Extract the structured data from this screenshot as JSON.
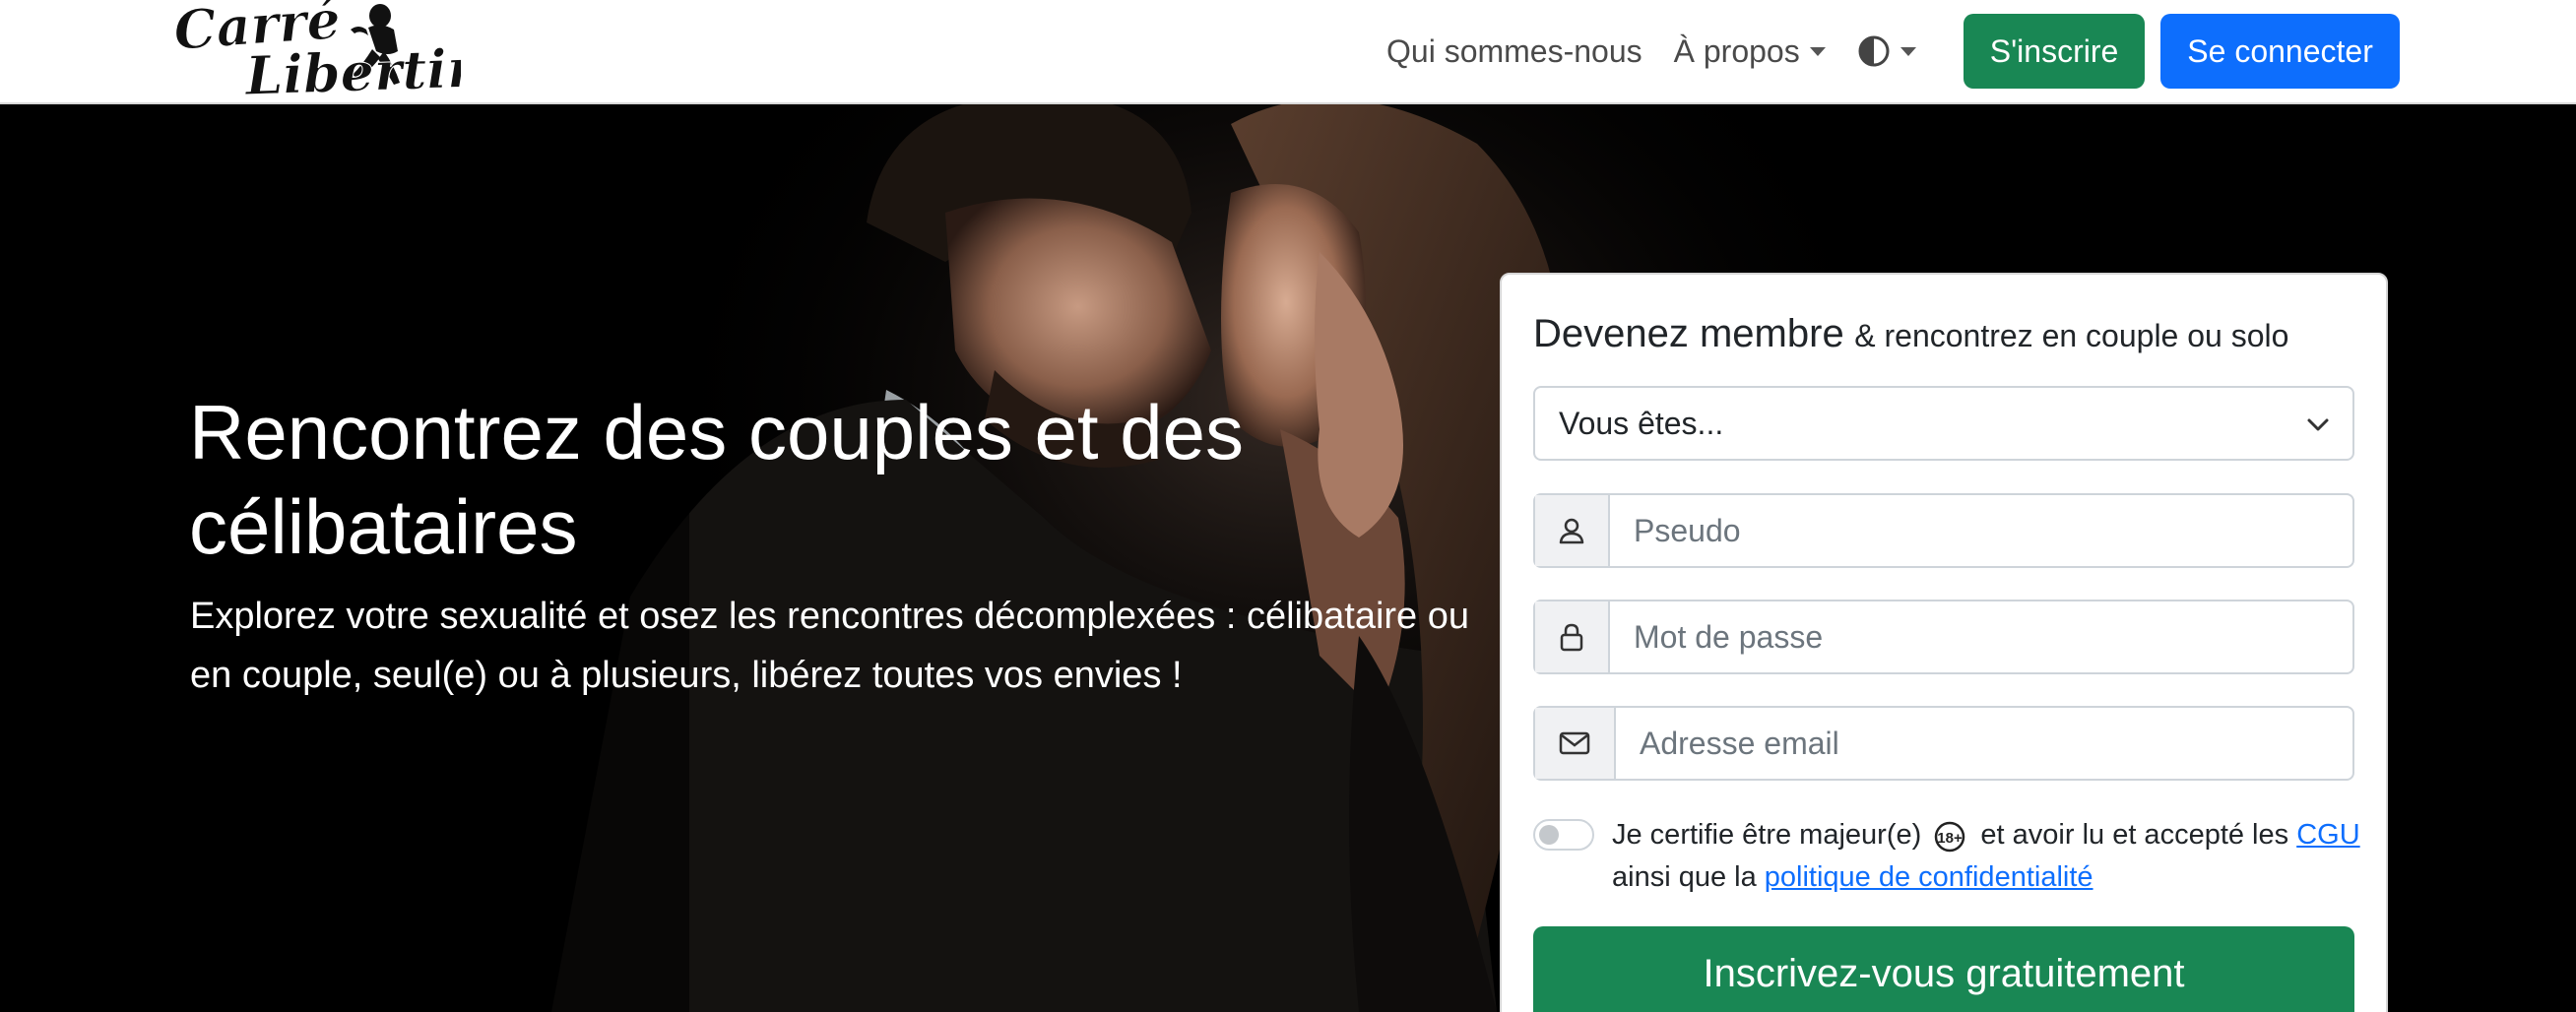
{
  "header": {
    "logo_text_line1": "Carré",
    "logo_text_line2": "Libertin",
    "nav": {
      "about_us": "Qui sommes-nous",
      "apropos": "À propos"
    },
    "signup_button": "S'inscrire",
    "login_button": "Se connecter",
    "colors": {
      "green": "#198754",
      "blue": "#0d6efd"
    }
  },
  "hero": {
    "title": "Rencontrez des couples et des célibataires",
    "subtitle": "Explorez votre sexualité et osez les rencontres décomplexées : célibataire ou en couple, seul(e) ou à plusieurs, libérez toutes vos envies !"
  },
  "signup_card": {
    "title_main": "Devenez membre",
    "title_rest": "& rencontrez en couple ou solo",
    "select_value": "Vous êtes...",
    "pseudo_placeholder": "Pseudo",
    "password_placeholder": "Mot de passe",
    "email_placeholder": "Adresse email",
    "consent_text_1": "Je certifie être majeur(e)",
    "consent_text_2": "et avoir lu et accepté les",
    "cgu_link": "CGU",
    "consent_text_3": "ainsi que la",
    "privacy_link": "politique de confidentialité",
    "age_badge": "18+",
    "submit_button": "Inscrivez-vous gratuitement",
    "icons": [
      "user-icon",
      "lock-icon",
      "envelope-icon",
      "chevron-down-icon"
    ]
  }
}
